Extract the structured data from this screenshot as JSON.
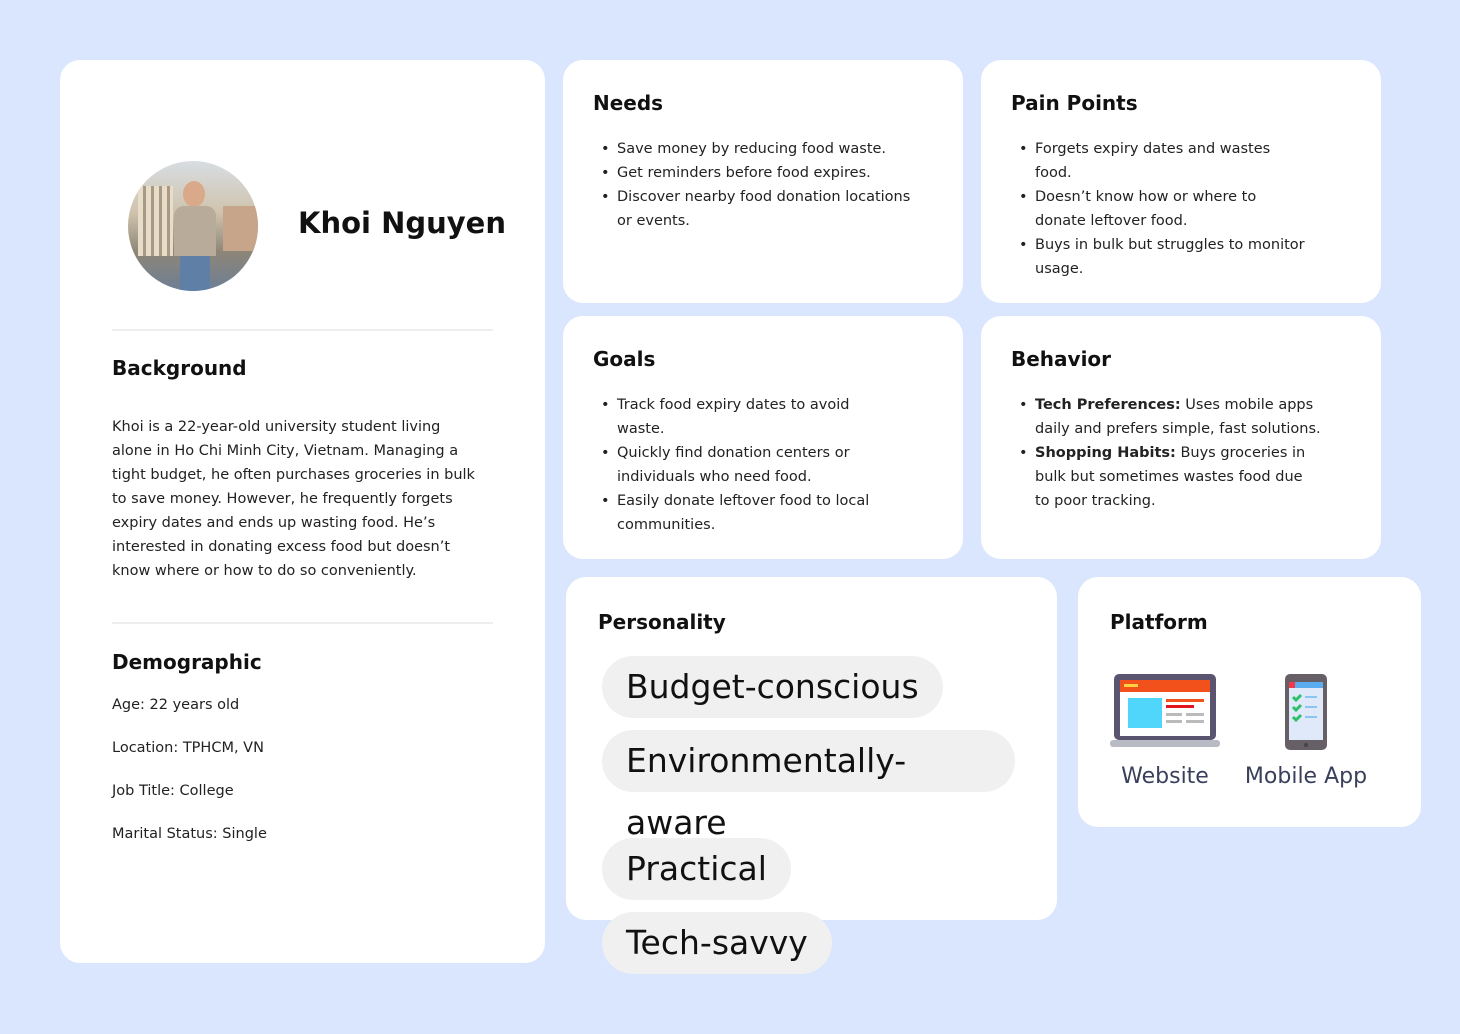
{
  "profile": {
    "name": "Khoi Nguyen",
    "avatar_alt": "student photo"
  },
  "background": {
    "title": "Background",
    "text": "Khoi is a 22-year-old university student living alone in Ho Chi Minh City, Vietnam. Managing a tight budget, he often purchases groceries in bulk to save money. However, he frequently forgets expiry dates and ends up wasting food. He’s interested in donating excess food but doesn’t know where or how to do so conveniently."
  },
  "demographic": {
    "title": "Demographic",
    "items": [
      "Age: 22 years old",
      "Location: TPHCM, VN",
      "Job Title: College",
      "Marital Status: Single"
    ]
  },
  "needs": {
    "title": "Needs",
    "items": [
      "Save money by reducing food waste.",
      "Get reminders before food expires.",
      "Discover nearby food donation locations or events."
    ]
  },
  "pain_points": {
    "title": "Pain Points",
    "items": [
      "Forgets expiry dates and wastes food.",
      "Doesn’t know how or where to donate leftover food.",
      "Buys in bulk but struggles to monitor usage."
    ]
  },
  "goals": {
    "title": "Goals",
    "items": [
      "Track food expiry dates to avoid waste.",
      "Quickly find donation centers or individuals who need food.",
      "Easily donate leftover food to local communities."
    ]
  },
  "behavior": {
    "title": "Behavior",
    "items": [
      {
        "label": "Tech Preferences:",
        "text": " Uses mobile apps daily and prefers simple, fast solutions."
      },
      {
        "label": "Shopping Habits:",
        "text": " Buys groceries in bulk but sometimes wastes food due to poor tracking."
      }
    ]
  },
  "personality": {
    "title": "Personality",
    "tags": [
      "Budget-conscious",
      "Environmentally-aware",
      "Practical",
      "Tech-savvy"
    ]
  },
  "platform": {
    "title": "Platform",
    "items": [
      {
        "label": "Website",
        "icon": "laptop-icon"
      },
      {
        "label": "Mobile App",
        "icon": "phone-icon"
      }
    ]
  }
}
